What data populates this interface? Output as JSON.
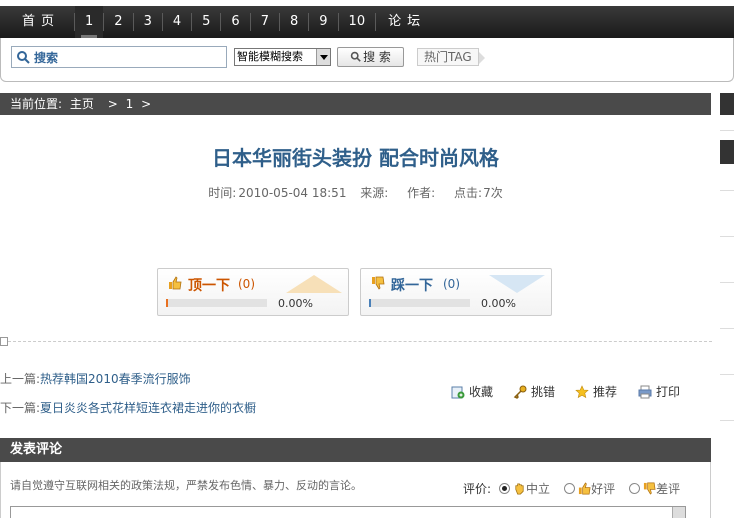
{
  "nav": {
    "home": "首页",
    "pages": [
      "1",
      "2",
      "3",
      "4",
      "5",
      "6",
      "7",
      "8",
      "9",
      "10"
    ],
    "active": "1",
    "forum": "论坛"
  },
  "search": {
    "placeholder": "搜索",
    "mode": "智能模糊搜索",
    "button": "搜 索",
    "hot_tag": "热门TAG"
  },
  "breadcrumb": {
    "prefix": "当前位置:",
    "home": "主页",
    "sep1": ">",
    "page": "1",
    "sep2": ">"
  },
  "article": {
    "title": "日本华丽街头装扮 配合时尚风格",
    "time_label": "时间:",
    "time_value": "2010-05-04 18:51",
    "source_label": "来源:",
    "author_label": "作者:",
    "hits_label": "点击:",
    "hits_value": "7次"
  },
  "votes": {
    "up": {
      "label": "顶一下",
      "count": "(0)",
      "percent": "0.00%",
      "fraction": 0.0
    },
    "down": {
      "label": "踩一下",
      "count": "(0)",
      "percent": "0.00%",
      "fraction": 0.0
    }
  },
  "prevnext": {
    "prev_label": "上一篇:",
    "prev_title": "热荐韩国2010春季流行服饰",
    "next_label": "下一篇:",
    "next_title": "夏日炎炎各式花样短连衣裙走进你的衣橱"
  },
  "tools": {
    "favorite": "收藏",
    "report": "挑错",
    "recommend": "推荐",
    "print": "打印"
  },
  "comment": {
    "header": "发表评论",
    "notice": "请自觉遵守互联网相关的政策法规，严禁发布色情、暴力、反动的言论。",
    "rating_label": "评价:",
    "options": [
      "中立",
      "好评",
      "差评"
    ],
    "selected": "中立"
  },
  "colors": {
    "nav_bg": "#222222",
    "link": "#2f5f8a",
    "up_accent": "#cc5500",
    "down_accent": "#336699"
  }
}
